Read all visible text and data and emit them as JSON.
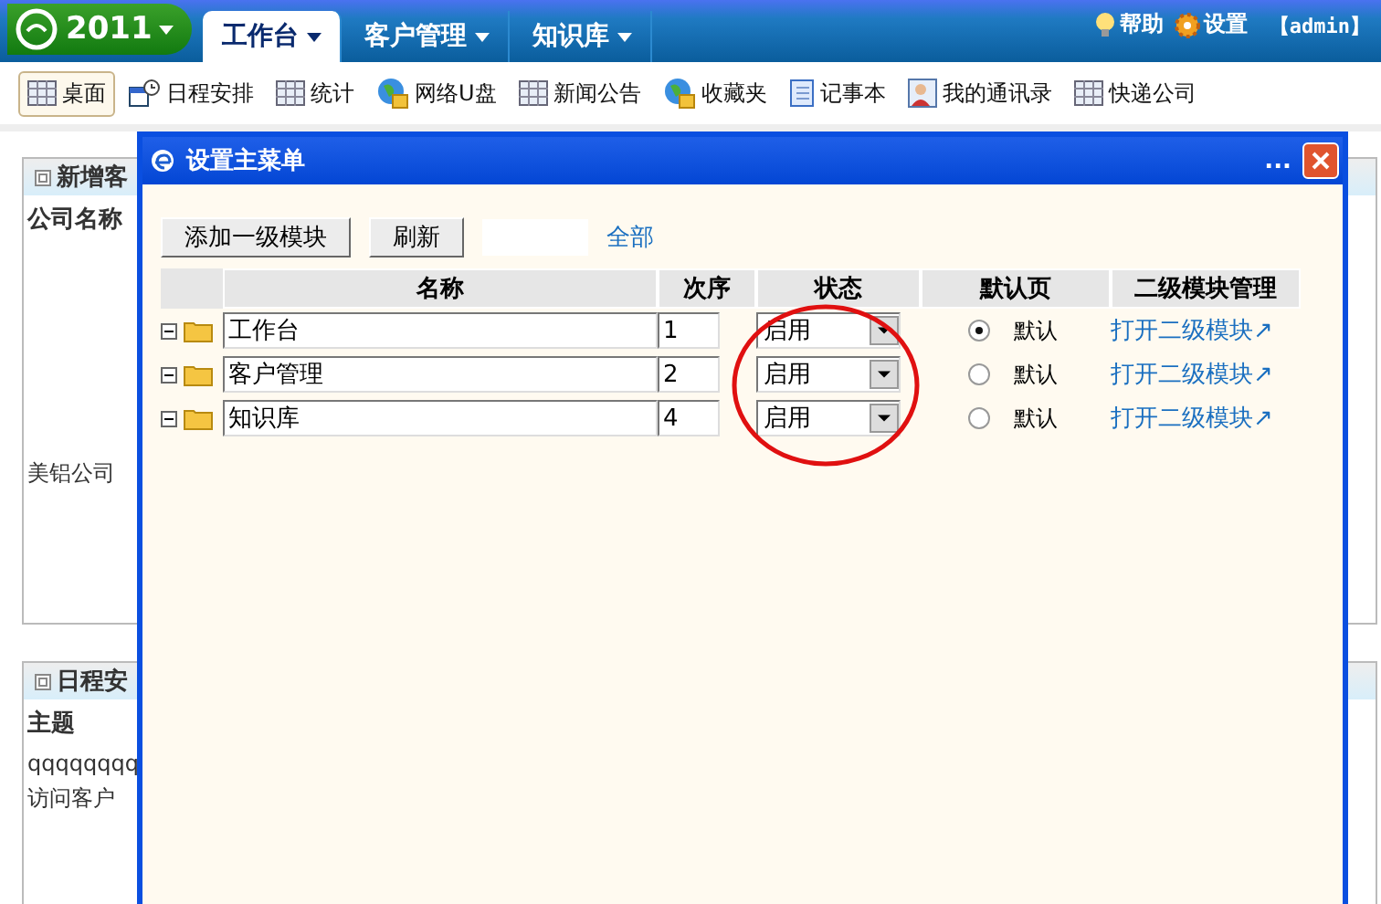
{
  "top_nav": {
    "logo": "2011",
    "tabs": [
      {
        "label": "工作台",
        "selected": true
      },
      {
        "label": "客户管理",
        "selected": false
      },
      {
        "label": "知识库",
        "selected": false
      }
    ],
    "links": [
      {
        "label": "帮助",
        "kind": "bulb"
      },
      {
        "label": "设置",
        "kind": "gear"
      }
    ],
    "user": "【admin】"
  },
  "toolbar": [
    {
      "label": "桌面",
      "kind": "grid",
      "selected": true
    },
    {
      "label": "日程安排",
      "kind": "calendar",
      "selected": false
    },
    {
      "label": "统计",
      "kind": "grid",
      "selected": false
    },
    {
      "label": "网络U盘",
      "kind": "globe",
      "selected": false
    },
    {
      "label": "新闻公告",
      "kind": "grid",
      "selected": false
    },
    {
      "label": "收藏夹",
      "kind": "globe",
      "selected": false
    },
    {
      "label": "记事本",
      "kind": "notebook",
      "selected": false
    },
    {
      "label": "我的通讯录",
      "kind": "contact",
      "selected": false
    },
    {
      "label": "快递公司",
      "kind": "grid",
      "selected": false
    }
  ],
  "background_panels": [
    {
      "title": "新增客",
      "header": "公司名称",
      "rows": [
        "美铝公司"
      ]
    },
    {
      "title": "日程安",
      "header": "主题",
      "rows": [
        "qqqqqqqq",
        "访问客户"
      ]
    }
  ],
  "dialog": {
    "title": "设置主菜单",
    "menu": "...",
    "buttons": [
      "添加一级模块",
      "刷新"
    ],
    "filter_link": "全部",
    "columns": [
      "名称",
      "次序",
      "状态",
      "默认页",
      "二级模块管理"
    ],
    "rows": [
      {
        "name": "工作台",
        "order": "1",
        "status": "启用",
        "default_label": "默认",
        "selected": true,
        "link": "打开二级模块↗"
      },
      {
        "name": "客户管理",
        "order": "2",
        "status": "启用",
        "default_label": "默认",
        "selected": false,
        "link": "打开二级模块↗"
      },
      {
        "name": "知识库",
        "order": "4",
        "status": "启用",
        "default_label": "默认",
        "selected": false,
        "link": "打开二级模块↗"
      }
    ]
  }
}
